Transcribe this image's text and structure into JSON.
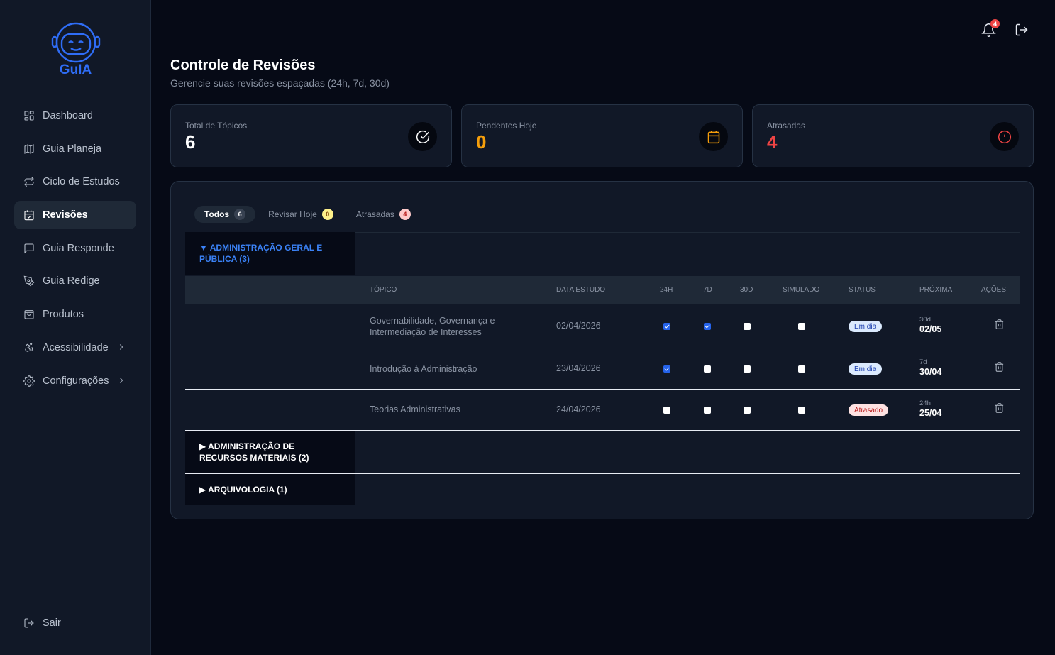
{
  "brand": {
    "name": "GuIA"
  },
  "nav": [
    {
      "label": "Dashboard",
      "icon": "dashboard-icon"
    },
    {
      "label": "Guia Planeja",
      "icon": "map-icon"
    },
    {
      "label": "Ciclo de Estudos",
      "icon": "repeat-icon"
    },
    {
      "label": "Revisões",
      "icon": "calendar-check-icon",
      "active": true
    },
    {
      "label": "Guia Responde",
      "icon": "chat-icon"
    },
    {
      "label": "Guia Redige",
      "icon": "pen-icon"
    },
    {
      "label": "Produtos",
      "icon": "bag-icon"
    },
    {
      "label": "Acessibilidade",
      "icon": "accessibility-icon"
    },
    {
      "label": "Configurações",
      "icon": "gear-icon"
    }
  ],
  "sidebar_footer": {
    "logout_label": "Sair"
  },
  "topbar": {
    "notifications_count": "4"
  },
  "header": {
    "title": "Controle de Revisões",
    "subtitle": "Gerencie suas revisões espaçadas (24h, 7d, 30d)"
  },
  "stats": [
    {
      "label": "Total de Tópicos",
      "value": "6",
      "color": "#ffffff",
      "icon": "check-circle-icon"
    },
    {
      "label": "Pendentes Hoje",
      "value": "0",
      "color": "#f59e0b",
      "icon": "calendar-icon"
    },
    {
      "label": "Atrasadas",
      "value": "4",
      "color": "#ef4444",
      "icon": "alert-circle-icon"
    }
  ],
  "tabs": [
    {
      "label": "Todos",
      "count": "6",
      "active": true,
      "count_bg": "#374151",
      "count_color": "#ffffff"
    },
    {
      "label": "Revisar Hoje",
      "count": "0",
      "count_bg": "#fef08a",
      "count_color": "#854d0e"
    },
    {
      "label": "Atrasadas",
      "count": "4",
      "count_bg": "#fecaca",
      "count_color": "#b91c1c"
    }
  ],
  "table_headers": {
    "topic": "TÓPICO",
    "date": "DATA ESTUDO",
    "h24": "24H",
    "d7": "7D",
    "d30": "30D",
    "sim": "SIMULADO",
    "status": "STATUS",
    "next": "PRÓXIMA",
    "actions": "AÇÕES"
  },
  "groups": [
    {
      "title": "▼ ADMINISTRAÇÃO GERAL E PÚBLICA (3)",
      "expanded": true
    },
    {
      "title": "▶ ADMINISTRAÇÃO DE RECURSOS MATERIAIS (2)",
      "expanded": false
    },
    {
      "title": "▶ ARQUIVOLOGIA (1)",
      "expanded": false
    }
  ],
  "rows": [
    {
      "topic": "Governabilidade, Governança e Intermediação de Interesses",
      "date": "02/04/2026",
      "h24": true,
      "d7": true,
      "d30": false,
      "sim": false,
      "status": "Em dia",
      "status_type": "ok",
      "next_label": "30d",
      "next_date": "02/05"
    },
    {
      "topic": "Introdução à Administração",
      "date": "23/04/2026",
      "h24": true,
      "d7": false,
      "d30": false,
      "sim": false,
      "status": "Em dia",
      "status_type": "ok",
      "next_label": "7d",
      "next_date": "30/04"
    },
    {
      "topic": "Teorias Administrativas",
      "date": "24/04/2026",
      "h24": false,
      "d7": false,
      "d30": false,
      "sim": false,
      "status": "Atrasado",
      "status_type": "late",
      "next_label": "24h",
      "next_date": "25/04"
    }
  ]
}
